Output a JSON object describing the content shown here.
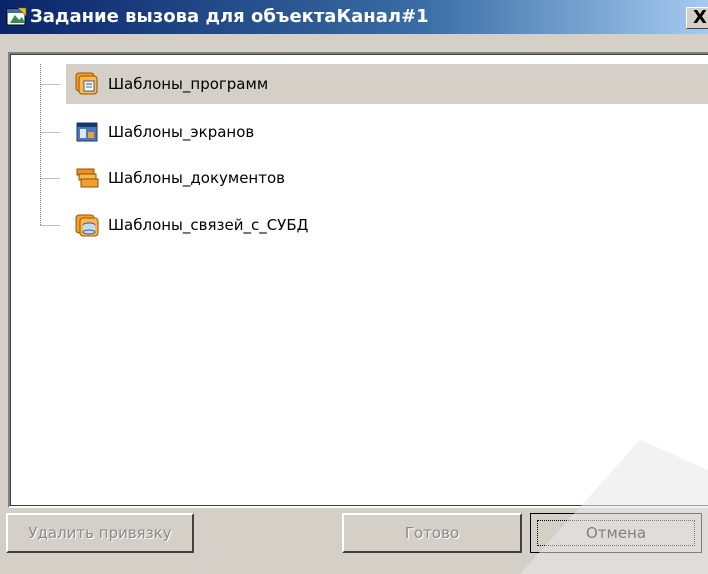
{
  "window": {
    "title": "Задание вызова для объектаКанал#1",
    "close_glyph": "X"
  },
  "tree": {
    "items": [
      {
        "label": "Шаблоны_программ",
        "icon": "program-templates-icon",
        "selected": true
      },
      {
        "label": "Шаблоны_экранов",
        "icon": "screen-templates-icon",
        "selected": false
      },
      {
        "label": "Шаблоны_документов",
        "icon": "document-templates-icon",
        "selected": false
      },
      {
        "label": "Шаблоны_связей_с_СУБД",
        "icon": "dbms-link-templates-icon",
        "selected": false
      }
    ]
  },
  "buttons": {
    "remove_binding": {
      "label": "Удалить привязку",
      "enabled": false
    },
    "done": {
      "label": "Готово",
      "enabled": false
    },
    "cancel": {
      "label": "Отмена",
      "enabled": true,
      "default": true
    }
  },
  "colors": {
    "titlebar_start": "#0a246a",
    "titlebar_end": "#a6caf0",
    "face": "#d4d0c8",
    "selection": "#d4d0c8"
  }
}
